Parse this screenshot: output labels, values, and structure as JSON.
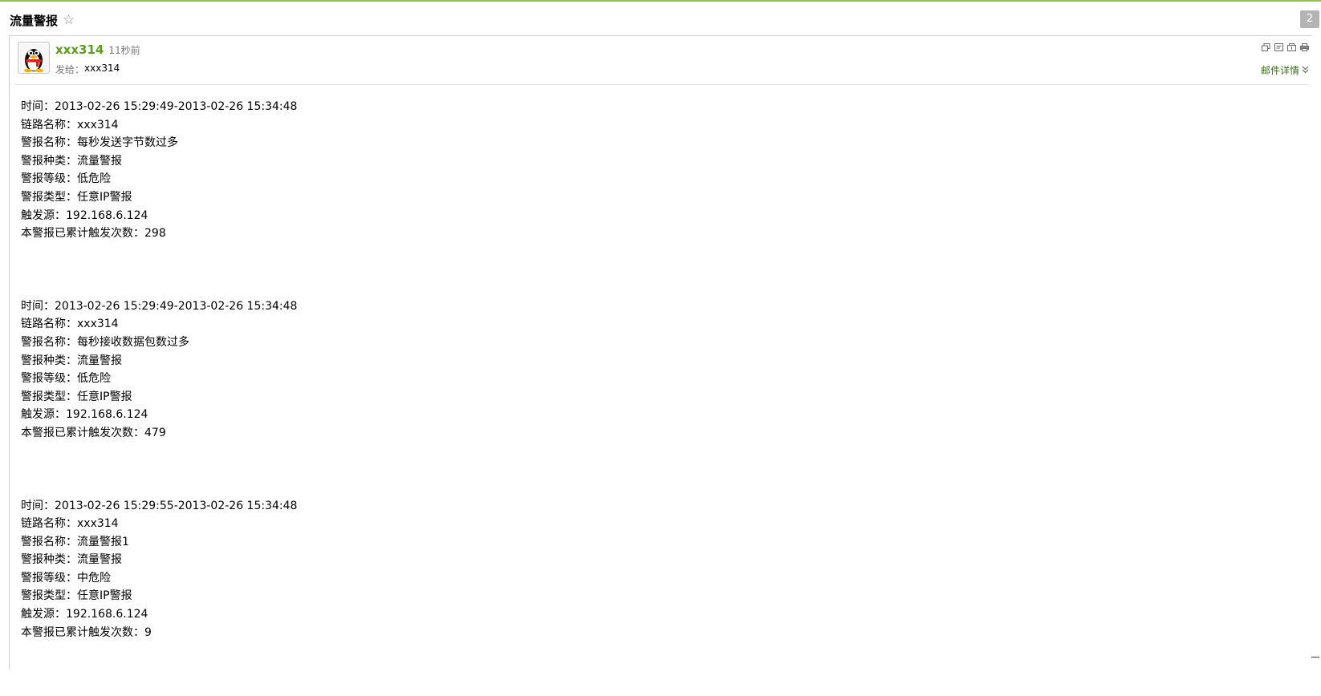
{
  "header": {
    "subject": "流量警报",
    "star_icon": "star-outline-icon",
    "count": "2"
  },
  "mail": {
    "sender_name": "xxx314",
    "sent_time": "11秒前",
    "to_label": "发给：",
    "to_value": "xxx314",
    "details_label": "邮件详情",
    "details_icon": "double-chevron-down-icon",
    "toolbar_icons": [
      "new-window-icon",
      "note-icon",
      "archive-icon",
      "print-icon"
    ],
    "avatar_icon": "penguin-avatar-icon"
  },
  "alerts": [
    {
      "time": "时间：2013-02-26 15:29:49-2013-02-26 15:34:48",
      "link": "链路名称：xxx314",
      "name": "警报名称：每秒发送字节数过多",
      "kind": "警报种类：流量警报",
      "level": "警报等级：低危险",
      "type": "警报类型：任意IP警报",
      "source": "触发源：192.168.6.124",
      "count": "本警报已累计触发次数：298"
    },
    {
      "time": "时间：2013-02-26 15:29:49-2013-02-26 15:34:48",
      "link": "链路名称：xxx314",
      "name": "警报名称：每秒接收数据包数过多",
      "kind": "警报种类：流量警报",
      "level": "警报等级：低危险",
      "type": "警报类型：任意IP警报",
      "source": "触发源：192.168.6.124",
      "count": "本警报已累计触发次数：479"
    },
    {
      "time": "时间：2013-02-26 15:29:55-2013-02-26 15:34:48",
      "link": "链路名称：xxx314",
      "name": "警报名称：流量警报1",
      "kind": "警报种类：流量警报",
      "level": "警报等级：中危险",
      "type": "警报类型：任意IP警报",
      "source": "触发源：192.168.6.124",
      "count": "本警报已累计触发次数：9"
    }
  ]
}
